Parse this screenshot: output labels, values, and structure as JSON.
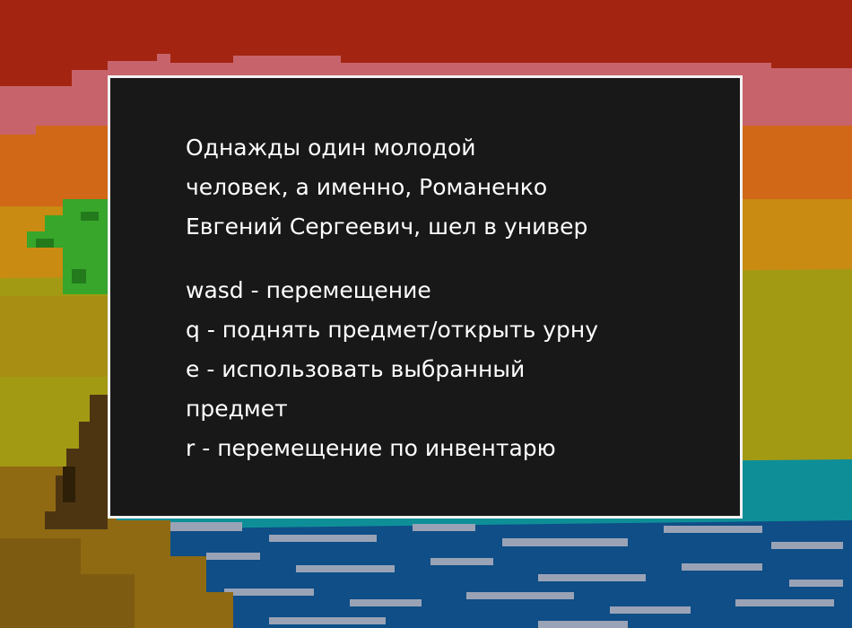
{
  "scene": {
    "colors": {
      "sky_top": "#a32511",
      "sky_pink": "#c7636b",
      "sky_orange": "#d06818",
      "sky_amber": "#c98b12",
      "horizon_olive": "#a39a14",
      "sea_teal": "#0e8f98",
      "sea_blue": "#0f4e87",
      "sea_foam": "#9aa3b6",
      "sand": "#8f6a12",
      "tree_trunk": "#4e3512",
      "palm_leaves": "#37a62b"
    },
    "icons": [
      "palm-tree-icon"
    ]
  },
  "dialog": {
    "story": [
      "Однажды один молодой",
      "человек, а именно, Романенко",
      "Евгений Сергеевич, шел в универ"
    ],
    "controls": [
      "wasd - перемещение",
      "q - поднять предмет/открыть урну",
      "e - использовать выбранный",
      "предмет",
      "r - перемещение по инвентарю"
    ]
  }
}
